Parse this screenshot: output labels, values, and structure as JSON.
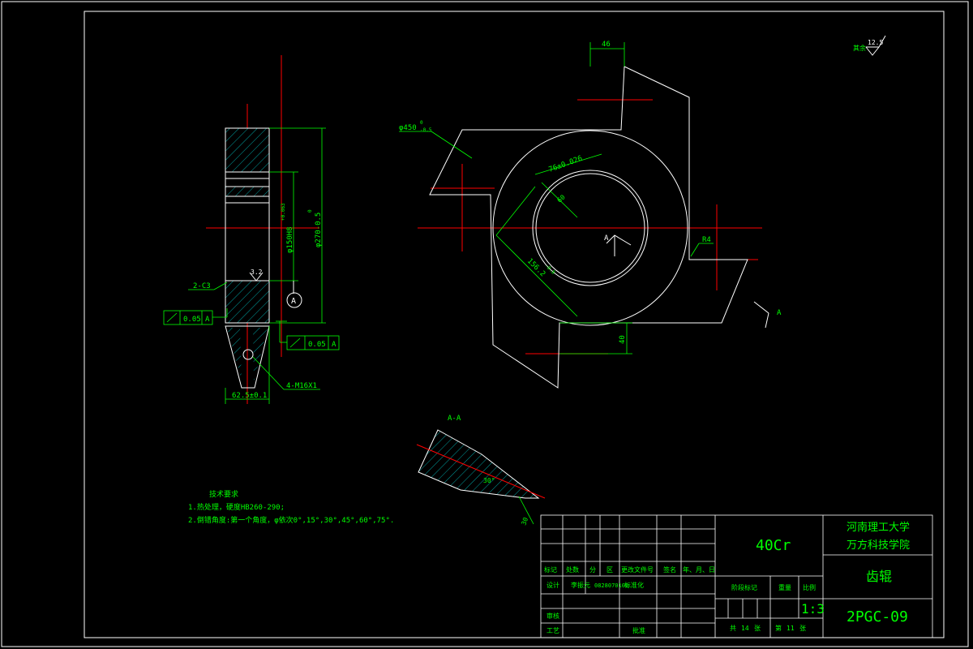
{
  "drawing": {
    "dims": {
      "top_width": "46",
      "outer_dia": "φ450",
      "outer_dia_tol_top": "0",
      "outer_dia_tol_bot": "-0.5",
      "bore": "76±0.026",
      "bore_small": "60",
      "chord": "156.2",
      "chord_tol": "-0.8",
      "r4": "R4",
      "slot": "40",
      "side_150": "φ150H8",
      "side_150_tol": "+0.063",
      "side_270": "φ270-0.5",
      "side_270_tol": "0",
      "chamfer": "2-C3",
      "thread": "4-M16X1",
      "width": "62.5±0.1",
      "roughness_small": "3.2",
      "section_label": "A",
      "section_title": "A-A",
      "section_angle": "30°",
      "section_dim": "30"
    },
    "tolerance": {
      "value": "0.05",
      "datum": "A"
    },
    "roughness": {
      "label": "其余",
      "value": "12.5"
    },
    "tech": {
      "title": "技术要求",
      "line1": "1.热处理，硬度HB260-290;",
      "line2": "2.倒错角度:第一个角度，φ依次0°,15°,30°,45°,60°,75°."
    }
  },
  "titleblock": {
    "material": "40Cr",
    "school1": "河南理工大学",
    "school2": "万方科技学院",
    "part_name": "齿辊",
    "drawing_no": "2PGC-09",
    "scale_label": "比例",
    "scale": "1:3",
    "stage_label": "阶段标记",
    "weight_label": "重量",
    "total_label": "共",
    "total": "14",
    "sheet_unit": "张",
    "page_label": "第",
    "page": "11",
    "page_unit": "张",
    "header": [
      "标记",
      "处数",
      "分",
      "区",
      "更改文件号",
      "签名",
      "年、月、日"
    ],
    "design_label": "设计",
    "designer": "李振元",
    "student_id": "0828070102",
    "std_label": "标准化",
    "review_label": "审核",
    "process_label": "工艺",
    "approve_label": "批准"
  }
}
